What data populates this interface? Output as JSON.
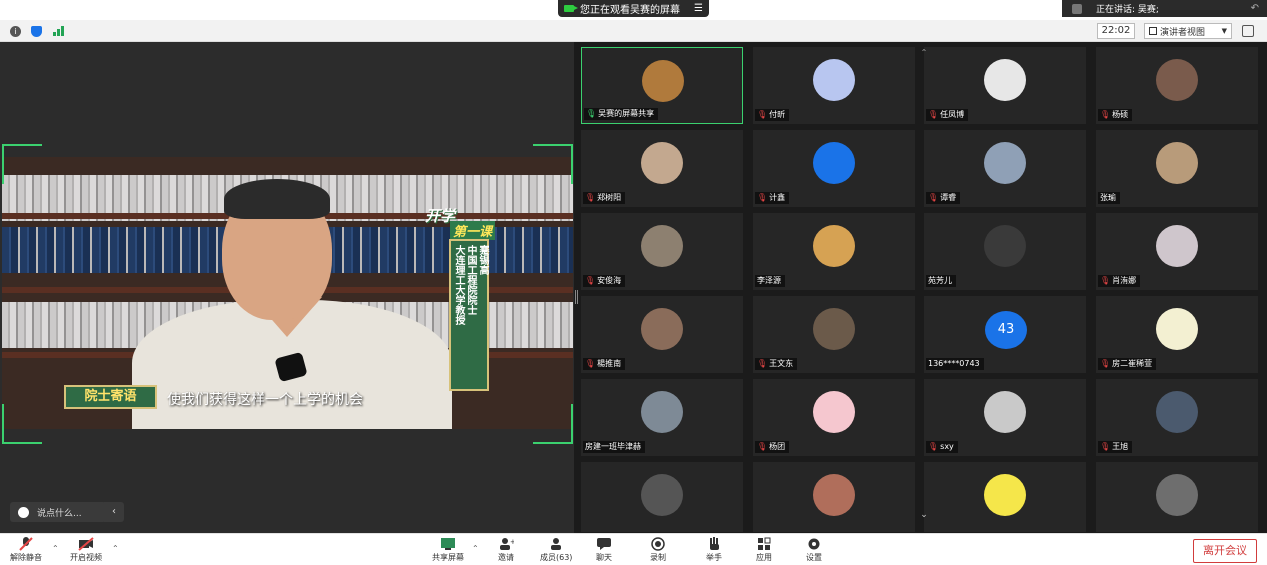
{
  "top": {
    "share_banner": "您正在观看吴赛的屏幕",
    "speaking": "正在讲话: 吴赛;"
  },
  "toolbar": {
    "time": "22:02",
    "view_mode": "演讲者视图"
  },
  "video": {
    "badge_line1": "开学",
    "badge_line2": "第一课",
    "title_col1": "大连理工大学教授",
    "title_col2": "中国工程院院士",
    "name": "蹇锡高",
    "tag": "院士寄语",
    "subtitle": "使我们获得这样一个上学的机会"
  },
  "chat": {
    "placeholder": "说点什么..."
  },
  "participants": [
    {
      "name": "吴赛的屏幕共享",
      "mic": "on",
      "active": true,
      "avatar": "#b07a3c"
    },
    {
      "name": "付昕",
      "mic": "off",
      "avatar": "#b8c6f0"
    },
    {
      "name": "任凤博",
      "mic": "off",
      "avatar": "#e7e7e7"
    },
    {
      "name": "杨硕",
      "mic": "off",
      "avatar": "#7a5b4c"
    },
    {
      "name": "郑树阳",
      "mic": "off",
      "avatar": "#c3a88f"
    },
    {
      "name": "计鑫",
      "mic": "off",
      "avatar": "#1a73e8"
    },
    {
      "name": "谭睿",
      "mic": "off",
      "avatar": "#8fa0b6"
    },
    {
      "name": "张瑜",
      "mic": "none",
      "avatar": "#b89b7a"
    },
    {
      "name": "安俊海",
      "mic": "off",
      "avatar": "#8d8070"
    },
    {
      "name": "李泽源",
      "mic": "none",
      "avatar": "#d6a253"
    },
    {
      "name": "苑芳儿",
      "mic": "none",
      "avatar": "#3a3a3a"
    },
    {
      "name": "肖洧娜",
      "mic": "off",
      "avatar": "#cfc6cc"
    },
    {
      "name": "楊推南",
      "mic": "off",
      "avatar": "#8a6c5a"
    },
    {
      "name": "王文东",
      "mic": "off",
      "avatar": "#6b5a4a"
    },
    {
      "name": "136****0743",
      "mic": "none",
      "badge": "43",
      "avatar": "#1a73e8"
    },
    {
      "name": "房二崔稀萱",
      "mic": "off",
      "avatar": "#f3f0d2"
    },
    {
      "name": "房建一班毕津赫",
      "mic": "none",
      "avatar": "#7e8a96"
    },
    {
      "name": "杨团",
      "mic": "off",
      "avatar": "#f5c7cf"
    },
    {
      "name": "sxy",
      "mic": "off",
      "avatar": "#c9c9c9"
    },
    {
      "name": "王旭",
      "mic": "off",
      "avatar": "#4b5a6e"
    },
    {
      "name": "",
      "mic": "off",
      "avatar": "#555"
    },
    {
      "name": "",
      "mic": "none",
      "avatar": "#b06e5b"
    },
    {
      "name": "",
      "mic": "none",
      "avatar": "#f5e64a"
    },
    {
      "name": "",
      "mic": "off",
      "avatar": "#6e6e6e"
    }
  ],
  "bottom": {
    "unmute": "解除静音",
    "start_video": "开启视频",
    "share": "共享屏幕",
    "invite": "邀请",
    "members": "成员(63)",
    "chat": "聊天",
    "record": "录制",
    "raise_hand": "举手",
    "apps": "应用",
    "settings": "设置",
    "leave": "离开会议"
  },
  "colors": {
    "accent_green": "#3bd16f",
    "leave_red": "#d13c3c",
    "brand_blue": "#1a73e8"
  }
}
